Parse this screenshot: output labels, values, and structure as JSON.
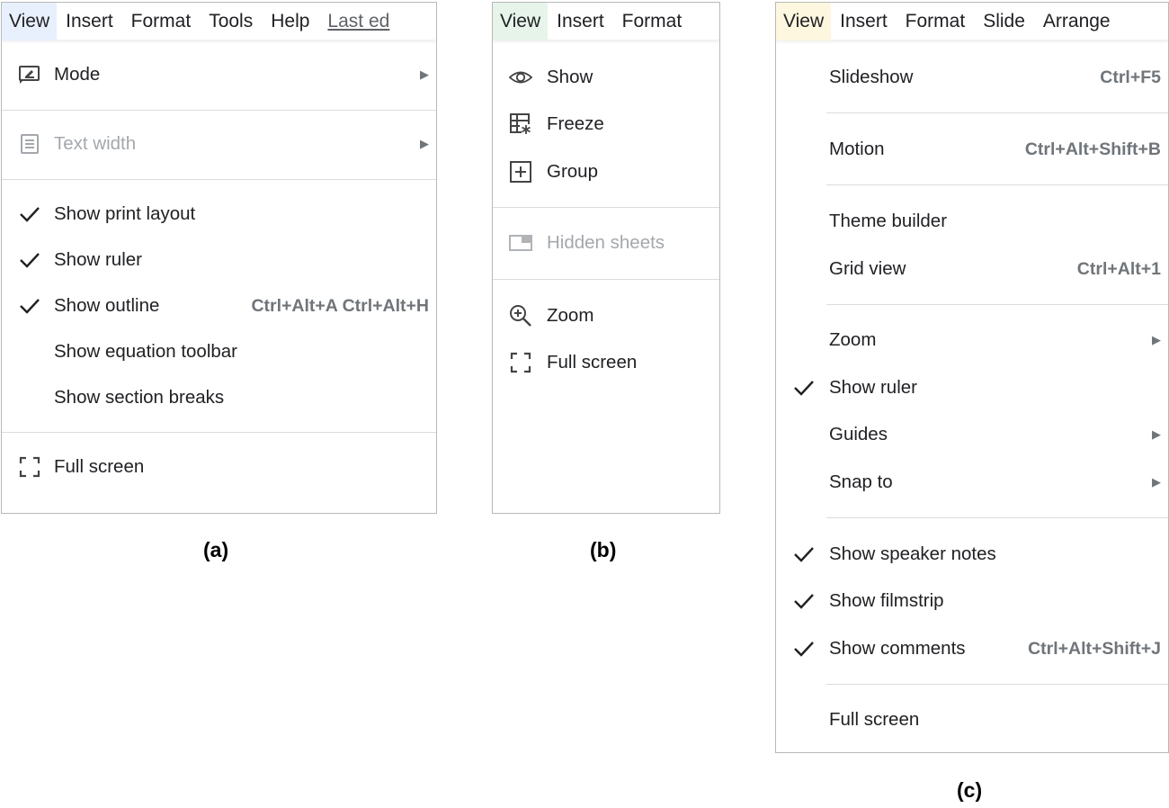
{
  "panel_a": {
    "menubar": [
      "View",
      "Insert",
      "Format",
      "Tools",
      "Help"
    ],
    "menubar_last": "Last ed",
    "items": [
      {
        "label": "Mode",
        "icon": "mode-icon"
      },
      {
        "label": "Text width",
        "icon": "text-width-icon",
        "disabled": true
      },
      {
        "label": "Show print layout",
        "checked": true
      },
      {
        "label": "Show ruler",
        "checked": true
      },
      {
        "label": "Show outline",
        "checked": true,
        "shortcut": "Ctrl+Alt+A Ctrl+Alt+H"
      },
      {
        "label": "Show equation toolbar"
      },
      {
        "label": "Show section breaks"
      },
      {
        "label": "Full screen",
        "icon": "fullscreen-icon"
      }
    ],
    "caption": "(a)"
  },
  "panel_b": {
    "menubar": [
      "View",
      "Insert",
      "Format"
    ],
    "items": [
      {
        "label": "Show",
        "icon": "eye-icon"
      },
      {
        "label": "Freeze",
        "icon": "freeze-icon"
      },
      {
        "label": "Group",
        "icon": "group-icon"
      },
      {
        "label": "Hidden sheets",
        "icon": "hidden-sheets-icon",
        "disabled": true
      },
      {
        "label": "Zoom",
        "icon": "zoom-icon"
      },
      {
        "label": "Full screen",
        "icon": "fullscreen-icon"
      }
    ],
    "caption": "(b)"
  },
  "panel_c": {
    "menubar": [
      "View",
      "Insert",
      "Format",
      "Slide",
      "Arrange"
    ],
    "items": [
      {
        "label": "Slideshow",
        "shortcut": "Ctrl+F5"
      },
      {
        "label": "Motion",
        "shortcut": "Ctrl+Alt+Shift+B"
      },
      {
        "label": "Theme builder"
      },
      {
        "label": "Grid view",
        "shortcut": "Ctrl+Alt+1"
      },
      {
        "label": "Zoom",
        "submenu": true
      },
      {
        "label": "Show ruler",
        "checked": true
      },
      {
        "label": "Guides",
        "submenu": true
      },
      {
        "label": "Snap to",
        "submenu": true
      },
      {
        "label": "Show speaker notes",
        "checked": true
      },
      {
        "label": "Show filmstrip",
        "checked": true
      },
      {
        "label": "Show comments",
        "checked": true,
        "shortcut": "Ctrl+Alt+Shift+J"
      },
      {
        "label": "Full screen"
      }
    ],
    "caption": "(c)"
  },
  "colors": {
    "docs_highlight": "#e8f0fe",
    "sheets_highlight": "#e6f4ea",
    "slides_highlight": "#fef7e0",
    "disabled_text": "#a4a8ac",
    "shortcut_text": "#70757a"
  }
}
